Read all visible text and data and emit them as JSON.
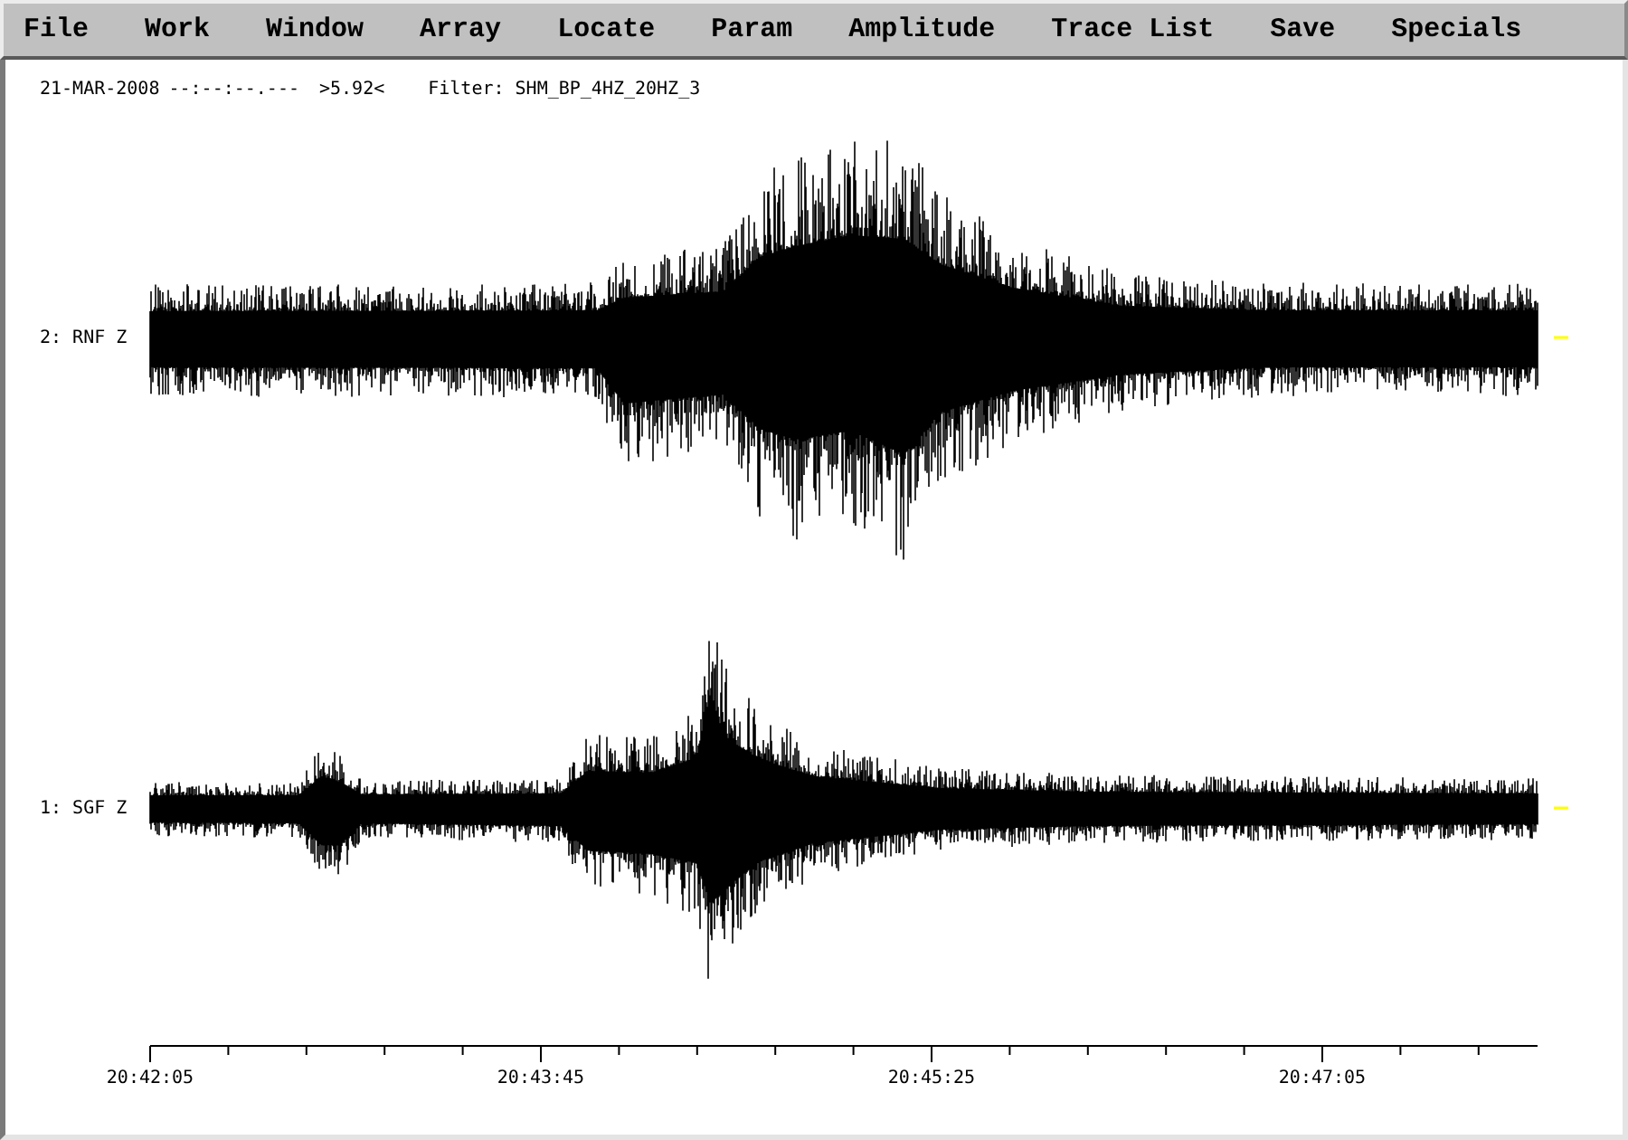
{
  "menu_bar": {
    "items": [
      "File",
      "Work",
      "Window",
      "Array",
      "Locate",
      "Param",
      "Amplitude",
      "Trace List",
      "Save",
      "Specials"
    ]
  },
  "header": {
    "date": "21-MAR-2008",
    "time": "--:--:--.---",
    "readout": ">5.92<",
    "filter": "Filter: SHM_BP_4HZ_20HZ_3"
  },
  "traces": [
    {
      "label": "2: RNF Z"
    },
    {
      "label": "1: SGF Z"
    }
  ],
  "time_axis": {
    "labels": [
      "20:42:05",
      "20:43:45",
      "20:45:25",
      "20:47:05"
    ]
  }
}
